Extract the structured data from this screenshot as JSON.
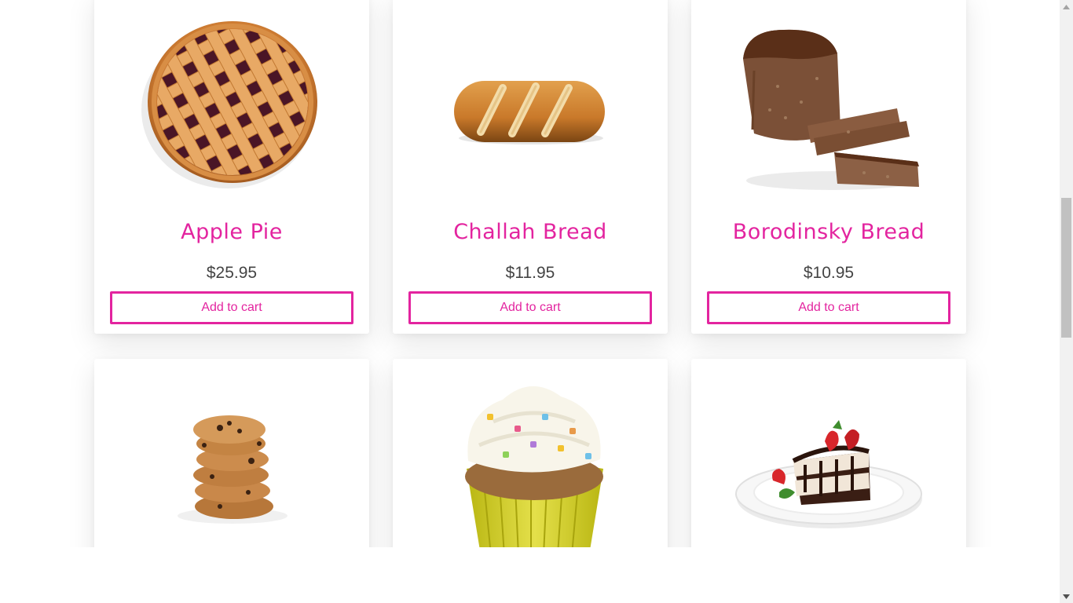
{
  "products": [
    {
      "name": "Apple Pie",
      "price": "$25.95",
      "button": "Add to cart",
      "image_icon": "apple-pie-image"
    },
    {
      "name": "Challah Bread",
      "price": "$11.95",
      "button": "Add to cart",
      "image_icon": "challah-bread-image"
    },
    {
      "name": "Borodinsky Bread",
      "price": "$10.95",
      "button": "Add to cart",
      "image_icon": "borodinsky-bread-image"
    },
    {
      "image_icon": "cookies-image"
    },
    {
      "image_icon": "cupcake-image"
    },
    {
      "image_icon": "cake-slice-image"
    }
  ],
  "colors": {
    "accent": "#e3249f",
    "price_text": "#444444",
    "card_background": "#ffffff",
    "scrollbar_track": "#f1f1f1",
    "scrollbar_thumb": "#c1c1c1"
  },
  "scrollbar": {
    "position_fraction": 0.34
  }
}
